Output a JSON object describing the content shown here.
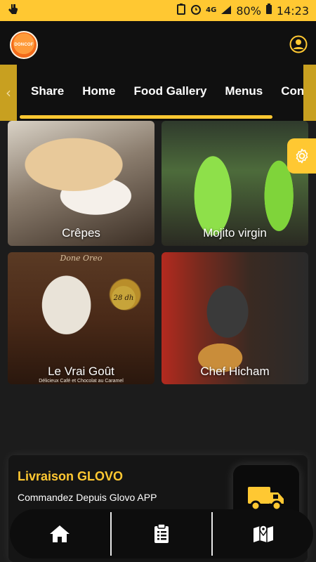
{
  "status_bar": {
    "network": "4G",
    "battery": "80%",
    "time": "14:23"
  },
  "header": {
    "logo_text": "DONCOF"
  },
  "nav": {
    "tabs": [
      "Share",
      "Home",
      "Food Gallery",
      "Menus",
      "Conta"
    ]
  },
  "gallery": {
    "cards": [
      {
        "label": "Crêpes"
      },
      {
        "label": "Mojito virgin"
      },
      {
        "label": "Le Vrai Goût",
        "image_title": "Done Oreo",
        "price": "28 dh",
        "subtitle": "Délicieux Café et Chocolat au Caramel"
      },
      {
        "label": "Chef Hicham"
      }
    ]
  },
  "glovo": {
    "title": "Livraison GLOVO",
    "subtitle": "Commandez Depuis Glovo APP"
  },
  "bottom_nav": {
    "items": [
      "home-icon",
      "clipboard-icon",
      "map-icon"
    ]
  },
  "colors": {
    "accent": "#ffc832",
    "background": "#1c1c1c",
    "dark": "#101010"
  }
}
